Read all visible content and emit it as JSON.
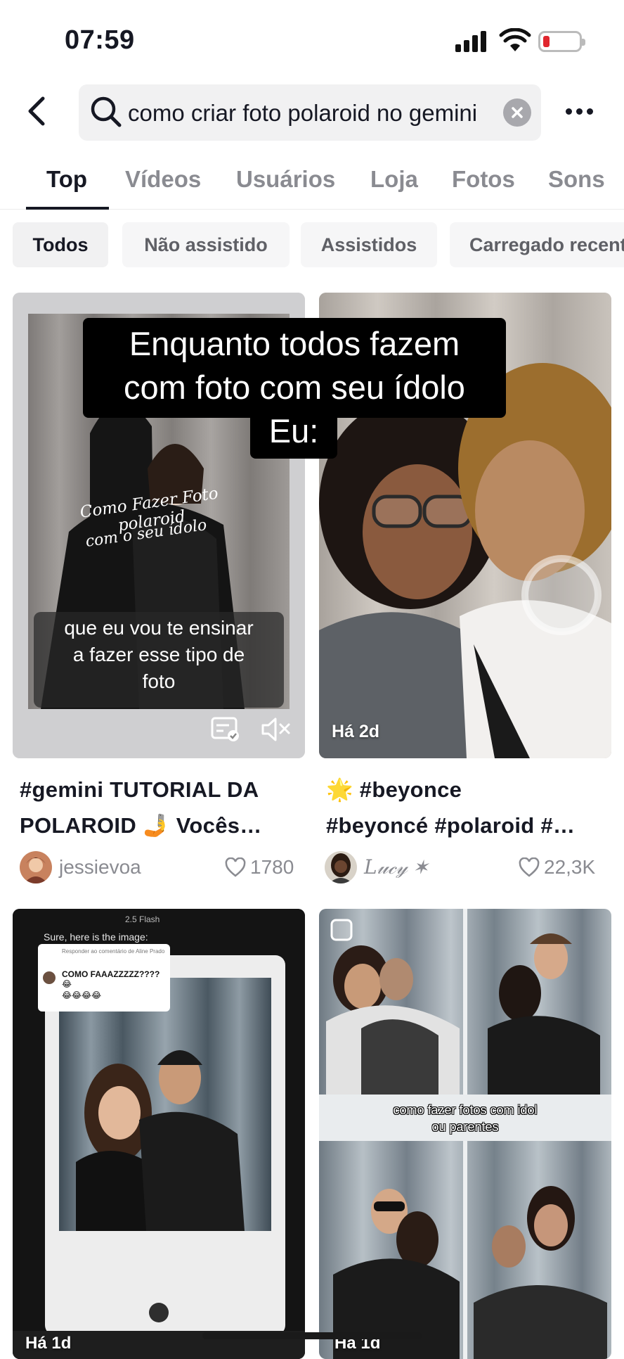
{
  "status_bar": {
    "time": "07:59"
  },
  "search": {
    "query": "como criar foto polaroid no gemini"
  },
  "tabs": [
    {
      "label": "Top"
    },
    {
      "label": "Vídeos"
    },
    {
      "label": "Usuários"
    },
    {
      "label": "Loja"
    },
    {
      "label": "Fotos"
    },
    {
      "label": "Sons"
    }
  ],
  "filters": [
    {
      "label": "Todos"
    },
    {
      "label": "Não assistido"
    },
    {
      "label": "Assistidos"
    },
    {
      "label": "Carregado recentemente"
    }
  ],
  "results": [
    {
      "caption_line1": "que eu vou te ensinar",
      "caption_line2": "a fazer esse tipo de",
      "caption_line3": "foto",
      "handwriting_line1": "Como Fazer Foto polaroid",
      "handwriting_line2": "com o seu ídolo",
      "title_line1": "#gemini TUTORIAL DA",
      "title_line2": "POLAROID 🤳 Vocês…",
      "author": "jessievoa",
      "likes": "1780"
    },
    {
      "time_ago": "Há 2d",
      "title_line1": "🌟 #beyonce",
      "title_line2": "#beyoncé #polaroid #…",
      "author": "𝐿𝓊𝒸𝓎 ✶",
      "likes": "22,3K"
    },
    {
      "time_ago": "Há 1d",
      "app_label": "2.5 Flash",
      "app_message": "Sure, here is the image:",
      "reply_to": "Responder ao comentário de Aline Prado",
      "reply_text": "COMO FAAAZZZZZ???? 😂",
      "reply_emojis": "😂😂😂😂"
    },
    {
      "time_ago": "Há 1d",
      "caption_line1": "como fazer fotos com idol",
      "caption_line2": "ou parentes"
    }
  ],
  "overlay": {
    "line1": "Enquanto todos fazem",
    "line2": "com foto com seu ídolo",
    "line3": "Eu:"
  }
}
